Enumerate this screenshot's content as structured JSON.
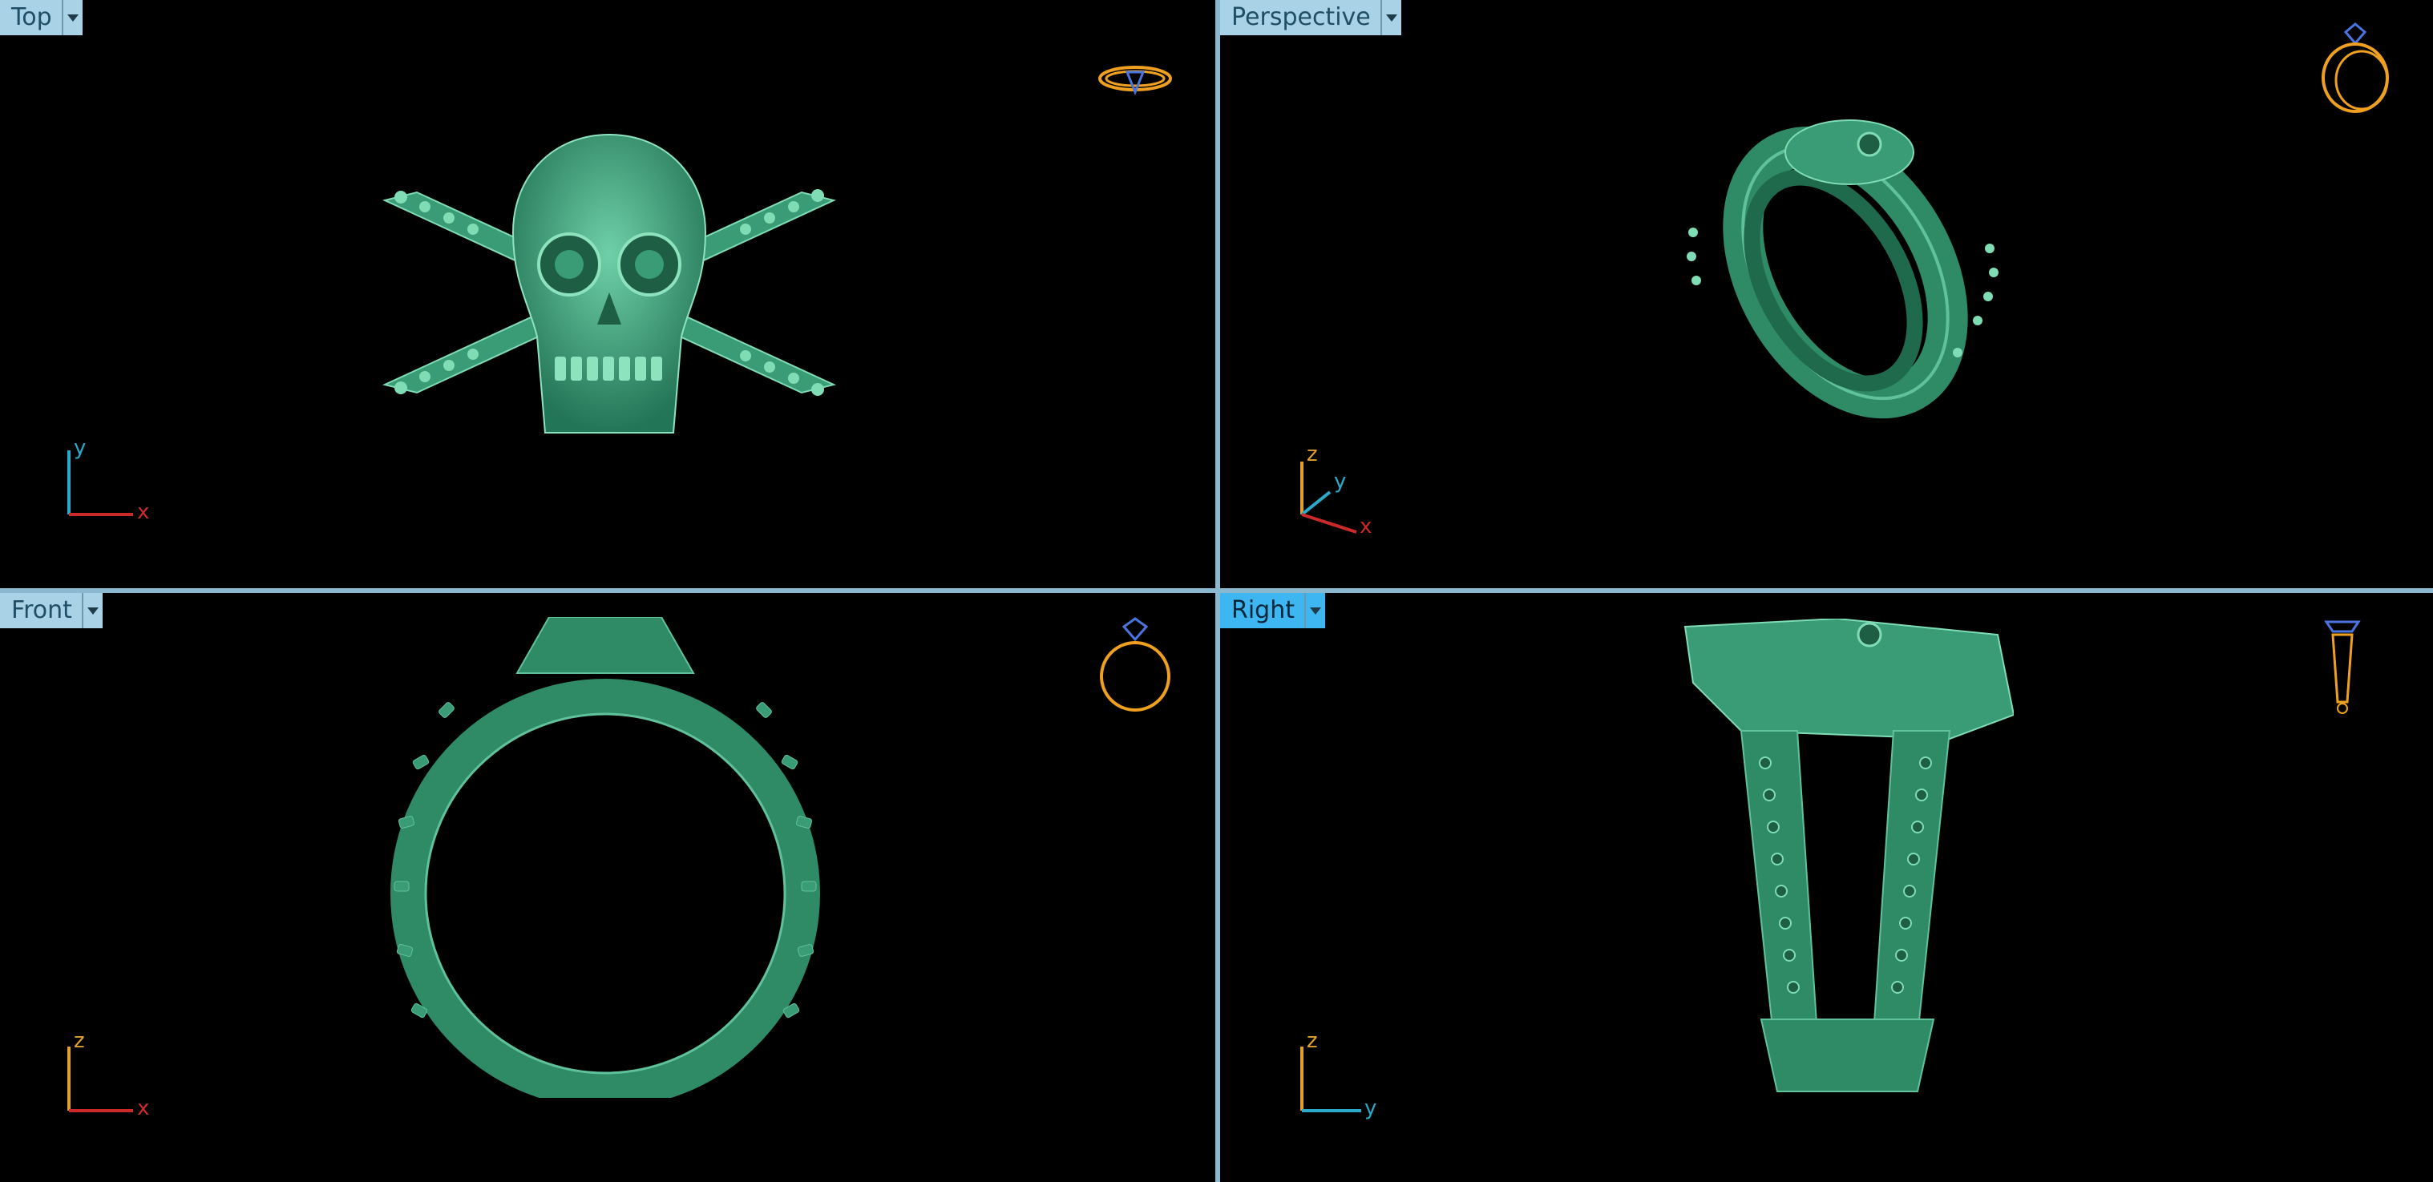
{
  "viewports": {
    "top": {
      "label": "Top",
      "active": false,
      "axis_h": "x",
      "axis_v": "y"
    },
    "perspective": {
      "label": "Perspective",
      "active": false,
      "axis_z": "z",
      "axis_y": "y",
      "axis_x": "x"
    },
    "front": {
      "label": "Front",
      "active": false,
      "axis_h": "x",
      "axis_v": "z"
    },
    "right": {
      "label": "Right",
      "active": true,
      "axis_h": "y",
      "axis_v": "z"
    }
  },
  "icons": {
    "view_widget": "ring-preview-icon",
    "dropdown": "chevron-down-icon"
  },
  "colors": {
    "background": "#000000",
    "model": "#2f8a66",
    "model_light": "#5fc29a",
    "x_axis": "#cc2a2a",
    "y_axis": "#2aa9c9",
    "z_axis": "#e0a030",
    "tab": "#a9d2e6",
    "tab_active": "#3db6f2",
    "widget_gold": "#f0a020",
    "widget_blue": "#4a74e0"
  }
}
